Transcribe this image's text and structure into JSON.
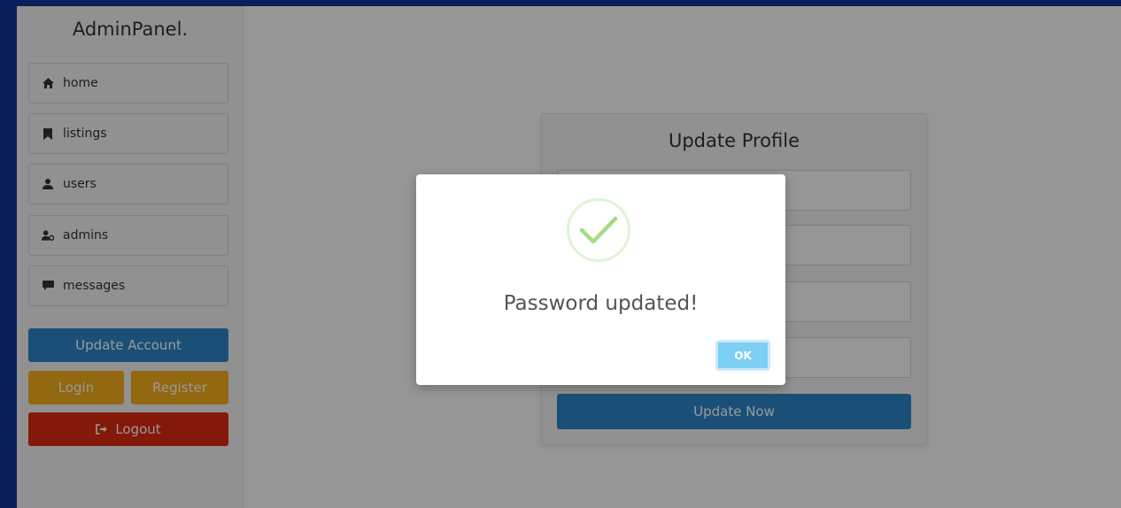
{
  "brand": {
    "title": "AdminPanel."
  },
  "sidebar": {
    "items": [
      {
        "label": "home",
        "icon": "home-icon"
      },
      {
        "label": "listings",
        "icon": "bookmark-icon"
      },
      {
        "label": "users",
        "icon": "user-icon"
      },
      {
        "label": "admins",
        "icon": "user-gear-icon"
      },
      {
        "label": "messages",
        "icon": "message-icon"
      }
    ],
    "update_account_label": "Update Account",
    "login_label": "Login",
    "register_label": "Register",
    "logout_label": "Logout"
  },
  "profile_form": {
    "title": "Update Profile",
    "fields": [
      {
        "value": "",
        "placeholder": ""
      },
      {
        "value": "",
        "placeholder": ""
      },
      {
        "value": "",
        "placeholder": ""
      },
      {
        "value": "",
        "placeholder": ""
      }
    ],
    "submit_label": "Update Now"
  },
  "alert": {
    "message": "Password updated!",
    "ok_label": "OK",
    "icon": "success-check-icon"
  },
  "colors": {
    "page_frame": "#0a1f5a",
    "primary_blue": "#2c86c7",
    "warning_orange": "#f3ad1c",
    "danger_red": "#dd2a10",
    "ok_button": "#7ecff4",
    "success_green": "#a5dc86"
  }
}
